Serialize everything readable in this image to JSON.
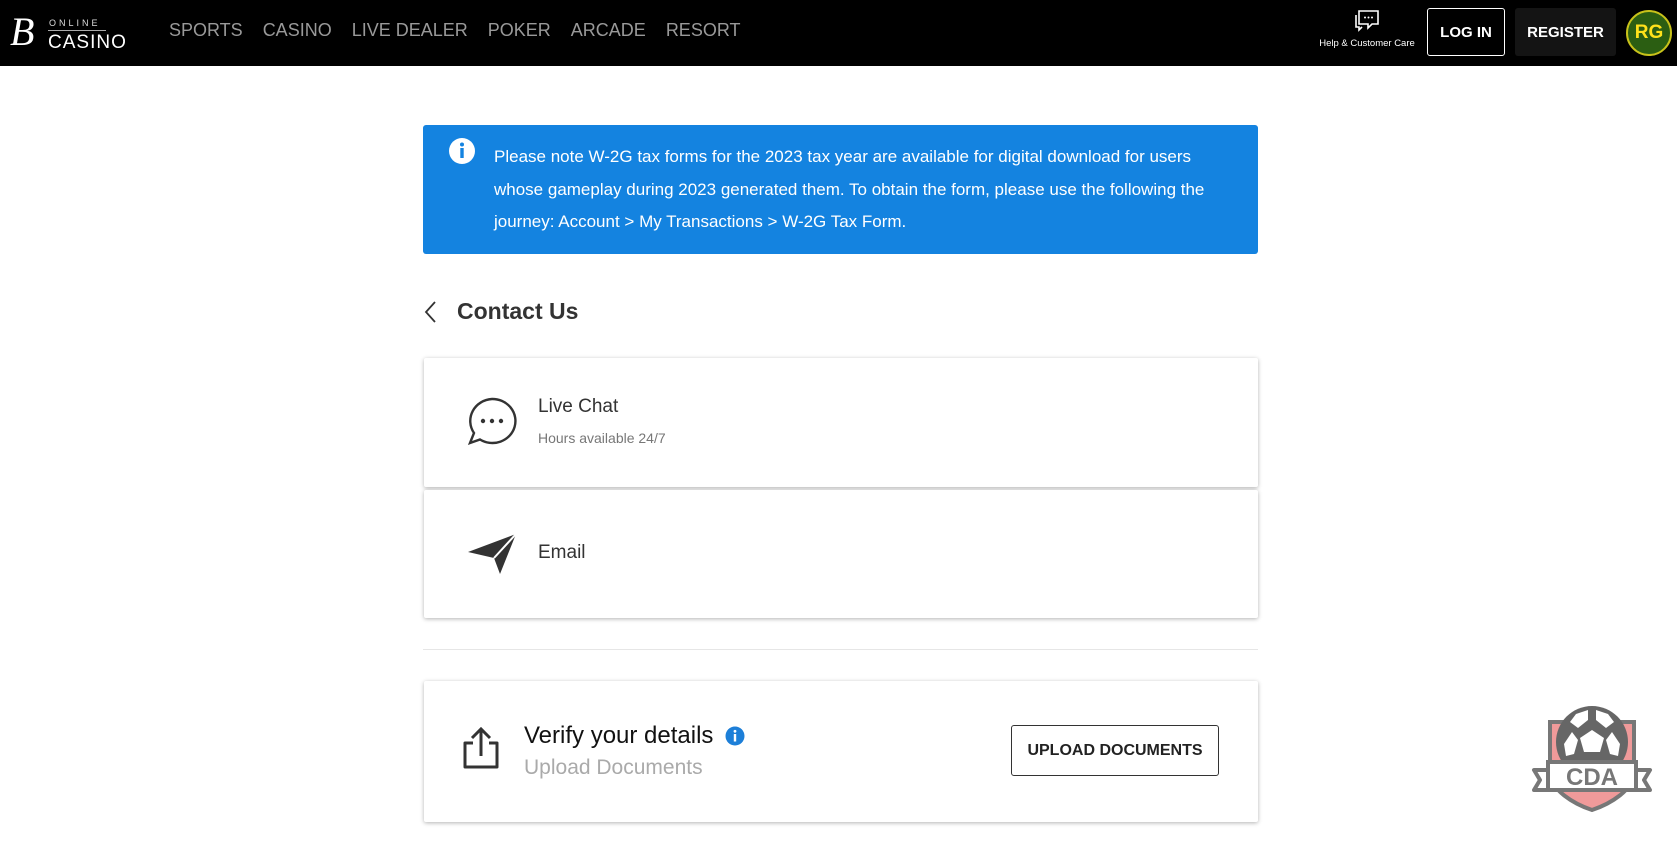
{
  "header": {
    "logo": {
      "letter": "B",
      "top": "ONLINE",
      "bottom": "CASINO"
    },
    "nav": [
      "SPORTS",
      "CASINO",
      "LIVE DEALER",
      "POKER",
      "ARCADE",
      "RESORT"
    ],
    "help_label": "Help & Customer Care",
    "login_label": "LOG IN",
    "register_label": "REGISTER",
    "rg_badge": "RG"
  },
  "banner": {
    "icon": "info-icon",
    "text": "Please note W-2G tax forms for the 2023 tax year are available for digital download for users whose gameplay during 2023 generated them. To obtain the form, please use the following the journey: Account > My Transactions > W-2G Tax Form.",
    "color": "#1483e0"
  },
  "page": {
    "title": "Contact Us"
  },
  "contact": [
    {
      "icon": "chat-bubble-icon",
      "title": "Live Chat",
      "subtitle": "Hours available 24/7"
    },
    {
      "icon": "paper-plane-icon",
      "title": "Email"
    }
  ],
  "verify": {
    "icon": "upload-icon",
    "title": "Verify your details",
    "subtitle": "Upload Documents",
    "button": "UPLOAD DOCUMENTS"
  },
  "cda_badge": "CDA"
}
